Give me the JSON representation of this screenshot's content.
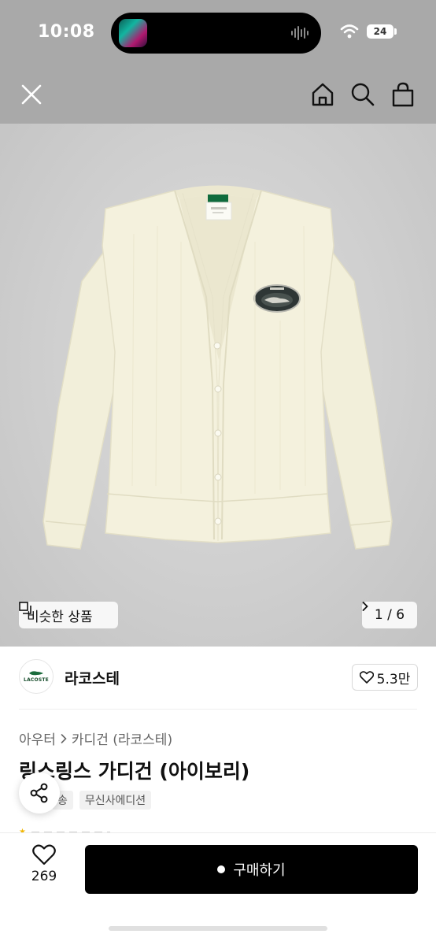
{
  "status_bar": {
    "time": "10:08",
    "battery": "24",
    "icons": [
      "music-art-icon",
      "audio-wave-icon",
      "wifi-icon",
      "battery-icon"
    ]
  },
  "header": {
    "icons": [
      "close-icon",
      "home-icon",
      "search-icon",
      "shopping-bag-icon"
    ]
  },
  "gallery": {
    "similar_label": "비슷한 상품",
    "counter_label": "1 / 6",
    "current_index": 1,
    "total": 6
  },
  "brand": {
    "name": "라코스테",
    "logo_text": "LACOSTE",
    "like_count": "5.3만"
  },
  "product": {
    "breadcrumb": [
      "아우터",
      "카디건 (라코스테)"
    ],
    "title": "링스링스 가디건 (아이보리)",
    "tags": [
      "송",
      "무신사에디션"
    ]
  },
  "bottom_bar": {
    "wish_count": "269",
    "buy_label": "구매하기"
  },
  "colors": {
    "header_bg": "#a9a9a9",
    "button_bg": "#000000",
    "cardigan": "#f4f1dd"
  }
}
